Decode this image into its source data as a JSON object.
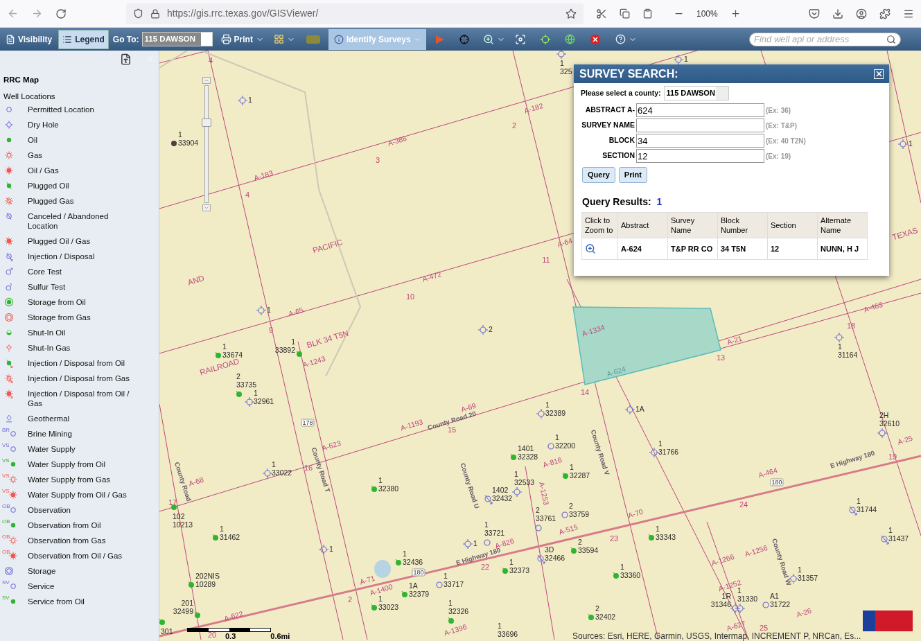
{
  "browser": {
    "url": "https://gis.rrc.texas.gov/GISViewer/",
    "zoom": "100%"
  },
  "toolbar": {
    "items": [
      {
        "kind": "visibility",
        "label": "Visibility",
        "selected": false
      },
      {
        "kind": "legend",
        "label": "Legend",
        "selected": true
      }
    ],
    "goto_label": "Go To:",
    "goto_value": "115 DAWSON",
    "print_label": "Print",
    "identify_label": "Identify Surveys",
    "identify_selected": true,
    "search_placeholder": "Find well api or address"
  },
  "legend": {
    "title": "RRC Map",
    "group": "Well Locations",
    "items": [
      {
        "label": "Permitted Location",
        "kind": "permitted"
      },
      {
        "label": "Dry Hole",
        "kind": "dry"
      },
      {
        "label": "Oil",
        "kind": "oil"
      },
      {
        "label": "Gas",
        "kind": "gas"
      },
      {
        "label": "Oil / Gas",
        "kind": "oilgas"
      },
      {
        "label": "Plugged Oil",
        "kind": "pluggedoil"
      },
      {
        "label": "Plugged Gas",
        "kind": "pluggedgas"
      },
      {
        "label": "Canceled / Abandoned Location",
        "kind": "canceled"
      },
      {
        "label": "Plugged Oil / Gas",
        "kind": "pluggedoilgas"
      },
      {
        "label": "Injection / Disposal",
        "kind": "injection"
      },
      {
        "label": "Core Test",
        "kind": "core"
      },
      {
        "label": "Sulfur Test",
        "kind": "sulfur"
      },
      {
        "label": "Storage from Oil",
        "kind": "storageoil"
      },
      {
        "label": "Storage from Gas",
        "kind": "storagegas"
      },
      {
        "label": "Shut-In Oil",
        "kind": "shutinoil"
      },
      {
        "label": "Shut-In Gas",
        "kind": "shutingas"
      },
      {
        "label": "Injection / Disposal from Oil",
        "kind": "injoil"
      },
      {
        "label": "Injection / Disposal from Gas",
        "kind": "injgas"
      },
      {
        "label": "Injection / Disposal from Oil / Gas",
        "kind": "injoilgas"
      },
      {
        "label": "Geothermal",
        "kind": "geothermal"
      },
      {
        "label": "Brine Mining",
        "kind": "permitted",
        "prefix": "BR"
      },
      {
        "label": "Water Supply",
        "kind": "permitted",
        "prefix": "VS"
      },
      {
        "label": "Water Supply from Oil",
        "kind": "oil",
        "prefix": "VS"
      },
      {
        "label": "Water Supply from Gas",
        "kind": "gas",
        "prefix": "VS"
      },
      {
        "label": "Water Supply from Oil / Gas",
        "kind": "oilgas",
        "prefix": "VS"
      },
      {
        "label": "Observation",
        "kind": "permitted",
        "prefix": "OB"
      },
      {
        "label": "Observation from Oil",
        "kind": "oil",
        "prefix": "OB"
      },
      {
        "label": "Observation from Gas",
        "kind": "gas",
        "prefix": "OB"
      },
      {
        "label": "Observation from Oil / Gas",
        "kind": "oilgas",
        "prefix": "OB"
      },
      {
        "label": "Storage",
        "kind": "storage"
      },
      {
        "label": "Service",
        "kind": "permitted",
        "prefix": "SV"
      },
      {
        "label": "Service from Oil",
        "kind": "oil",
        "prefix": "SV"
      }
    ]
  },
  "map": {
    "zoom_slider": {
      "level": 0.7
    },
    "labels": [
      {
        "kind": "section",
        "text": "4"
      },
      {
        "kind": "abstract",
        "text": "A-182"
      },
      {
        "kind": "section",
        "text": "2"
      },
      {
        "kind": "abstract",
        "text": "A-386"
      },
      {
        "kind": "section",
        "text": "3"
      },
      {
        "kind": "abstract",
        "text": "A-183"
      },
      {
        "kind": "section",
        "text": "4"
      },
      {
        "kind": "abstract",
        "text": "A-64"
      },
      {
        "kind": "section",
        "text": "11"
      },
      {
        "kind": "abstract",
        "text": "A-472"
      },
      {
        "kind": "section",
        "text": "10"
      },
      {
        "kind": "abstract",
        "text": "A-65"
      },
      {
        "kind": "section",
        "text": "9"
      },
      {
        "kind": "region",
        "text": "PACIFIC"
      },
      {
        "kind": "region",
        "text": "AND"
      },
      {
        "kind": "region",
        "text": "TEXAS"
      },
      {
        "kind": "region",
        "text": "RAILROAD"
      },
      {
        "kind": "region",
        "text": "BLK 34 T5N"
      },
      {
        "kind": "abstract",
        "text": "A-1243"
      },
      {
        "kind": "abstract",
        "text": "A-1334"
      },
      {
        "kind": "selected",
        "text": "A-624"
      },
      {
        "kind": "abstract",
        "text": "A-21"
      },
      {
        "kind": "section",
        "text": "13"
      },
      {
        "kind": "section",
        "text": "14"
      },
      {
        "kind": "abstract",
        "text": "A-463"
      },
      {
        "kind": "section",
        "text": "18"
      },
      {
        "kind": "shield",
        "text": "178"
      },
      {
        "kind": "abstract",
        "text": "A-69"
      },
      {
        "kind": "abstract",
        "text": "A-1193"
      },
      {
        "kind": "road",
        "text": "County Road 20"
      },
      {
        "kind": "section",
        "text": "15"
      },
      {
        "kind": "abstract",
        "text": "A-623"
      },
      {
        "kind": "section",
        "text": "16"
      },
      {
        "kind": "road",
        "text": "County Road T"
      },
      {
        "kind": "abstract",
        "text": "A-68"
      },
      {
        "kind": "section",
        "text": "17"
      },
      {
        "kind": "road",
        "text": "County Road"
      },
      {
        "kind": "road",
        "text": "County Road U"
      },
      {
        "kind": "road",
        "text": "County Road V"
      },
      {
        "kind": "abstract",
        "text": "A-816"
      },
      {
        "kind": "abstract",
        "text": "A-1253"
      },
      {
        "kind": "abstract",
        "text": "A-515"
      },
      {
        "kind": "abstract",
        "text": "A-70"
      },
      {
        "kind": "section",
        "text": "23"
      },
      {
        "kind": "section",
        "text": "24"
      },
      {
        "kind": "abstract",
        "text": "A-464"
      },
      {
        "kind": "shield",
        "text": "180"
      },
      {
        "kind": "road",
        "text": "E Highway 180"
      },
      {
        "kind": "section",
        "text": "19"
      },
      {
        "kind": "abstract",
        "text": "A-25"
      },
      {
        "kind": "abstract",
        "text": "A-826"
      },
      {
        "kind": "road",
        "text": "E Highway 180"
      },
      {
        "kind": "section",
        "text": "22"
      },
      {
        "kind": "shield",
        "text": "180"
      },
      {
        "kind": "abstract",
        "text": "A-71"
      },
      {
        "kind": "abstract",
        "text": "A-1400"
      },
      {
        "kind": "section",
        "text": "2"
      },
      {
        "kind": "abstract",
        "text": "A-622"
      },
      {
        "kind": "section",
        "text": "20"
      },
      {
        "kind": "abstract",
        "text": "A-1396"
      },
      {
        "kind": "abstract",
        "text": "A-1266"
      },
      {
        "kind": "abstract",
        "text": "A-1256"
      },
      {
        "kind": "abstract",
        "text": "A-1252"
      },
      {
        "kind": "road",
        "text": "County Road W"
      },
      {
        "kind": "abstract",
        "text": "A-26"
      },
      {
        "kind": "abstract",
        "text": "A-627"
      },
      {
        "kind": "section",
        "text": "25"
      }
    ],
    "wells": [
      {
        "kind": "dry",
        "lines": [
          "1"
        ]
      },
      {
        "kind": "dark",
        "lines": [
          "1",
          "33904"
        ]
      },
      {
        "kind": "dry",
        "lines": [
          "1",
          "325"
        ]
      },
      {
        "kind": "dry",
        "lines": [
          "1"
        ]
      },
      {
        "kind": "dry",
        "lines": [
          "2"
        ]
      },
      {
        "kind": "oil",
        "lines": [
          "1",
          "33674"
        ]
      },
      {
        "kind": "oil",
        "lines": [
          "1",
          "33892"
        ]
      },
      {
        "kind": "oil",
        "lines": [
          "2",
          "33735"
        ]
      },
      {
        "kind": "dry",
        "lines": [
          "1",
          "32961"
        ]
      },
      {
        "kind": "dry",
        "lines": [
          "1",
          "32389"
        ]
      },
      {
        "kind": "dry",
        "lines": [
          "1A"
        ]
      },
      {
        "kind": "oil",
        "lines": [
          "1401",
          "32328"
        ]
      },
      {
        "kind": "permitted",
        "lines": [
          "1",
          "32200"
        ]
      },
      {
        "kind": "dry",
        "lines": [
          "1",
          "31766"
        ]
      },
      {
        "kind": "oil",
        "lines": [
          "1",
          "32287"
        ]
      },
      {
        "kind": "dry",
        "lines": [
          "1",
          "33022"
        ]
      },
      {
        "kind": "oil",
        "lines": [
          "1",
          "32380"
        ]
      },
      {
        "kind": "dry",
        "lines": [
          "1",
          "32533"
        ]
      },
      {
        "kind": "injection",
        "lines": [
          "1402",
          "32432"
        ]
      },
      {
        "kind": "permitted",
        "lines": [
          "2",
          "33761"
        ]
      },
      {
        "kind": "permitted",
        "lines": [
          "2",
          "33759"
        ]
      },
      {
        "kind": "oil",
        "lines": [
          "102",
          "10213"
        ]
      },
      {
        "kind": "oil",
        "lines": [
          "1",
          "31462"
        ]
      },
      {
        "kind": "dry",
        "lines": [
          "1"
        ]
      },
      {
        "kind": "dry",
        "lines": [
          "1"
        ]
      },
      {
        "kind": "permitted",
        "lines": [
          "1",
          "33721"
        ]
      },
      {
        "kind": "injection",
        "lines": [
          "3D",
          "32466"
        ]
      },
      {
        "kind": "oil",
        "lines": [
          "2",
          "33594"
        ]
      },
      {
        "kind": "oil",
        "lines": [
          "1",
          "33343"
        ]
      },
      {
        "kind": "oil",
        "lines": [
          "1",
          "32436"
        ]
      },
      {
        "kind": "oil",
        "lines": [
          "1",
          "32373"
        ]
      },
      {
        "kind": "permitted",
        "lines": [
          "1",
          "33717"
        ]
      },
      {
        "kind": "oil",
        "lines": [
          "1A",
          "32379"
        ]
      },
      {
        "kind": "oil",
        "lines": [
          "1",
          "33023"
        ]
      },
      {
        "kind": "oil",
        "lines": [
          "1",
          "33360"
        ]
      },
      {
        "kind": "oil",
        "lines": [
          "202NIS",
          "10289"
        ]
      },
      {
        "kind": "oil",
        "lines": [
          "201",
          "32499"
        ]
      },
      {
        "kind": "oil",
        "lines": [
          "1",
          "32326"
        ]
      },
      {
        "kind": "oil",
        "lines": [
          "2",
          "32402"
        ]
      },
      {
        "kind": "dry",
        "lines": [
          "1",
          "31164"
        ]
      },
      {
        "kind": "dry",
        "lines": [
          "2H",
          "32610"
        ]
      },
      {
        "kind": "injection",
        "lines": [
          "1",
          "31744"
        ]
      },
      {
        "kind": "injection",
        "lines": [
          "1",
          "31437"
        ]
      },
      {
        "kind": "dry",
        "lines": [
          "1",
          "31357"
        ]
      },
      {
        "kind": "dry",
        "lines": [
          "1R",
          "31346"
        ]
      },
      {
        "kind": "dry",
        "lines": [
          "1",
          "31330"
        ]
      },
      {
        "kind": "permitted",
        "lines": [
          "A1",
          "31722"
        ]
      },
      {
        "kind": "oil",
        "lines": [
          "301"
        ]
      },
      {
        "kind": "dry",
        "lines": [
          "1"
        ]
      },
      {
        "kind": "dry",
        "lines": [
          "1"
        ]
      },
      {
        "lines": [
          "1",
          "33696"
        ]
      }
    ],
    "scale": [
      "0.3",
      "0.6mi"
    ],
    "attribution": "Sources: Esri, HERE, Garmin, USGS, Intermap, INCREMENT P, NRCan, Es..."
  },
  "dialog": {
    "title": "SURVEY SEARCH:",
    "county_label": "Please select a county:",
    "county_value": "115 DAWSON",
    "fields": [
      {
        "label": "ABSTRACT A-",
        "value": "624",
        "example": "(Ex: 36)"
      },
      {
        "label": "SURVEY NAME",
        "example": "(Ex: T&P)"
      },
      {
        "label": "BLOCK",
        "value": "34",
        "example": "(Ex: 40 T2N)"
      },
      {
        "label": "SECTION",
        "value": "12",
        "example": "(Ex: 19)"
      }
    ],
    "buttons": [
      "Query",
      "Print"
    ],
    "results_label": "Query Results:",
    "results_count": "1",
    "columns": [
      "Click to Zoom to",
      "Abstract",
      "Survey Name",
      "Block Number",
      "Section",
      "Alternate Name"
    ],
    "rows": [
      [
        "",
        "A-624",
        "T&P RR CO",
        "34 T5N",
        "12",
        "NUNN, H J"
      ]
    ]
  }
}
